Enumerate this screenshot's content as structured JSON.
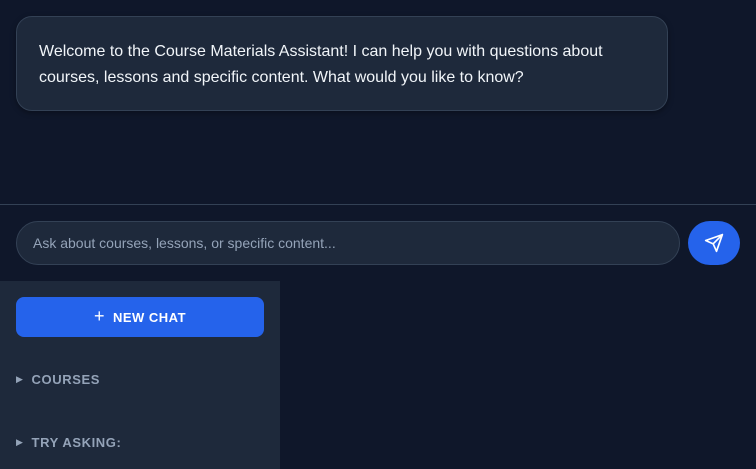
{
  "chat": {
    "welcome_message": "Welcome to the Course Materials Assistant! I can help you with questions about courses, lessons and specific content. What would you like to know?"
  },
  "input": {
    "placeholder": "Ask about courses, lessons, or specific content...",
    "value": ""
  },
  "send_button": {
    "icon": "paper-plane-icon"
  },
  "sidebar": {
    "new_chat_label": "NEW CHAT",
    "new_chat_icon": "+",
    "sections": [
      {
        "label": "COURSES",
        "icon": "triangle-right-icon"
      },
      {
        "label": "TRY ASKING:",
        "icon": "triangle-right-icon"
      }
    ]
  },
  "colors": {
    "background": "#0f172a",
    "surface": "#1e293b",
    "border": "#334155",
    "accent": "#2563eb",
    "text_primary": "#f1f5f9",
    "text_muted": "#94a3b8"
  }
}
